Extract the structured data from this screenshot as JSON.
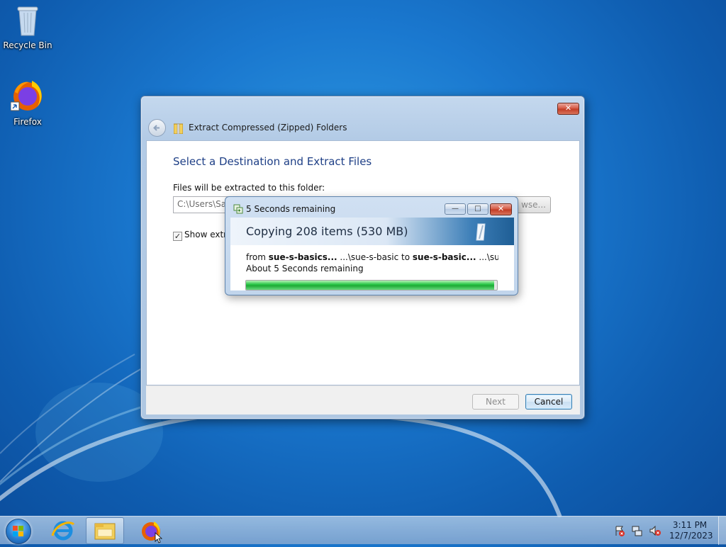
{
  "desktop": {
    "icons": [
      {
        "label": "Recycle Bin",
        "icon": "recycle-bin-icon"
      },
      {
        "label": "Firefox",
        "icon": "firefox-icon"
      }
    ]
  },
  "wizard": {
    "title": "Extract Compressed (Zipped) Folders",
    "heading": "Select a Destination and Extract Files",
    "destination_label": "Files will be extracted to this folder:",
    "destination_value": "C:\\Users\\Sar",
    "browse_label": "wse...",
    "show_files_label": "Show extra",
    "show_files_checked": true,
    "next_label": "Next",
    "cancel_label": "Cancel",
    "close_label": "✕"
  },
  "copy_dialog": {
    "title": "5 Seconds remaining",
    "banner": "Copying 208 items (530 MB)",
    "from_word": "from",
    "from_name": "sue-s-basics...",
    "from_path": "...\\sue-s-basic",
    "to_word": "to",
    "to_name": "sue-s-basic...",
    "to_path": "...\\sue-s-basic",
    "remaining": "About 5 Seconds remaining",
    "progress": 0.99,
    "minimize_label": "—",
    "maximize_label": "□",
    "close_label": "✕"
  },
  "taskbar": {
    "items": [
      "start-button",
      "internet-explorer",
      "windows-explorer",
      "firefox"
    ],
    "clock_time": "3:11 PM",
    "clock_date": "12/7/2023"
  },
  "colors": {
    "wizard_heading": "#1e3f86",
    "progress_green": "#2cc84a",
    "close_red": "#c03a23"
  }
}
